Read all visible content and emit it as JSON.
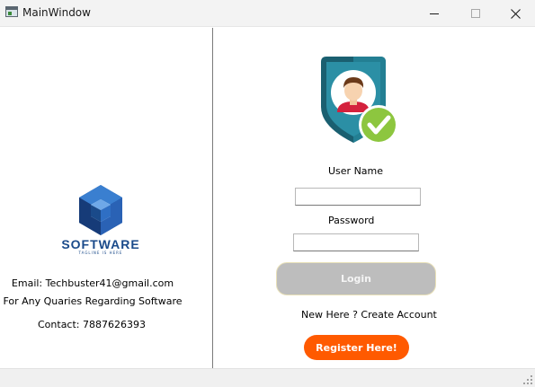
{
  "window": {
    "title": "MainWindow"
  },
  "left_panel": {
    "logo": {
      "wordmark": "SOFTWARE",
      "tagline": "TAGLINE IS HERE"
    },
    "email": "Email: Techbuster41@gmail.com",
    "queries": "For Any Quaries Regarding Software",
    "contact": "Contact: 7887626393"
  },
  "login_form": {
    "username_label": "User Name",
    "username_value": "",
    "password_label": "Password",
    "password_value": "",
    "login_label": "Login",
    "new_here_text": "New Here ? Create Account",
    "register_label": "Register Here!"
  },
  "colors": {
    "register_accent": "#ff5a00",
    "login_disabled": "#bdbdbd",
    "shield_teal": "#1f6d80",
    "check_green": "#8dc63f",
    "logo_blue": "#1a4a8a"
  },
  "icons": {
    "app": "app-window-icon",
    "shield": "user-shield-check-icon",
    "logo": "cube-logo-icon"
  }
}
